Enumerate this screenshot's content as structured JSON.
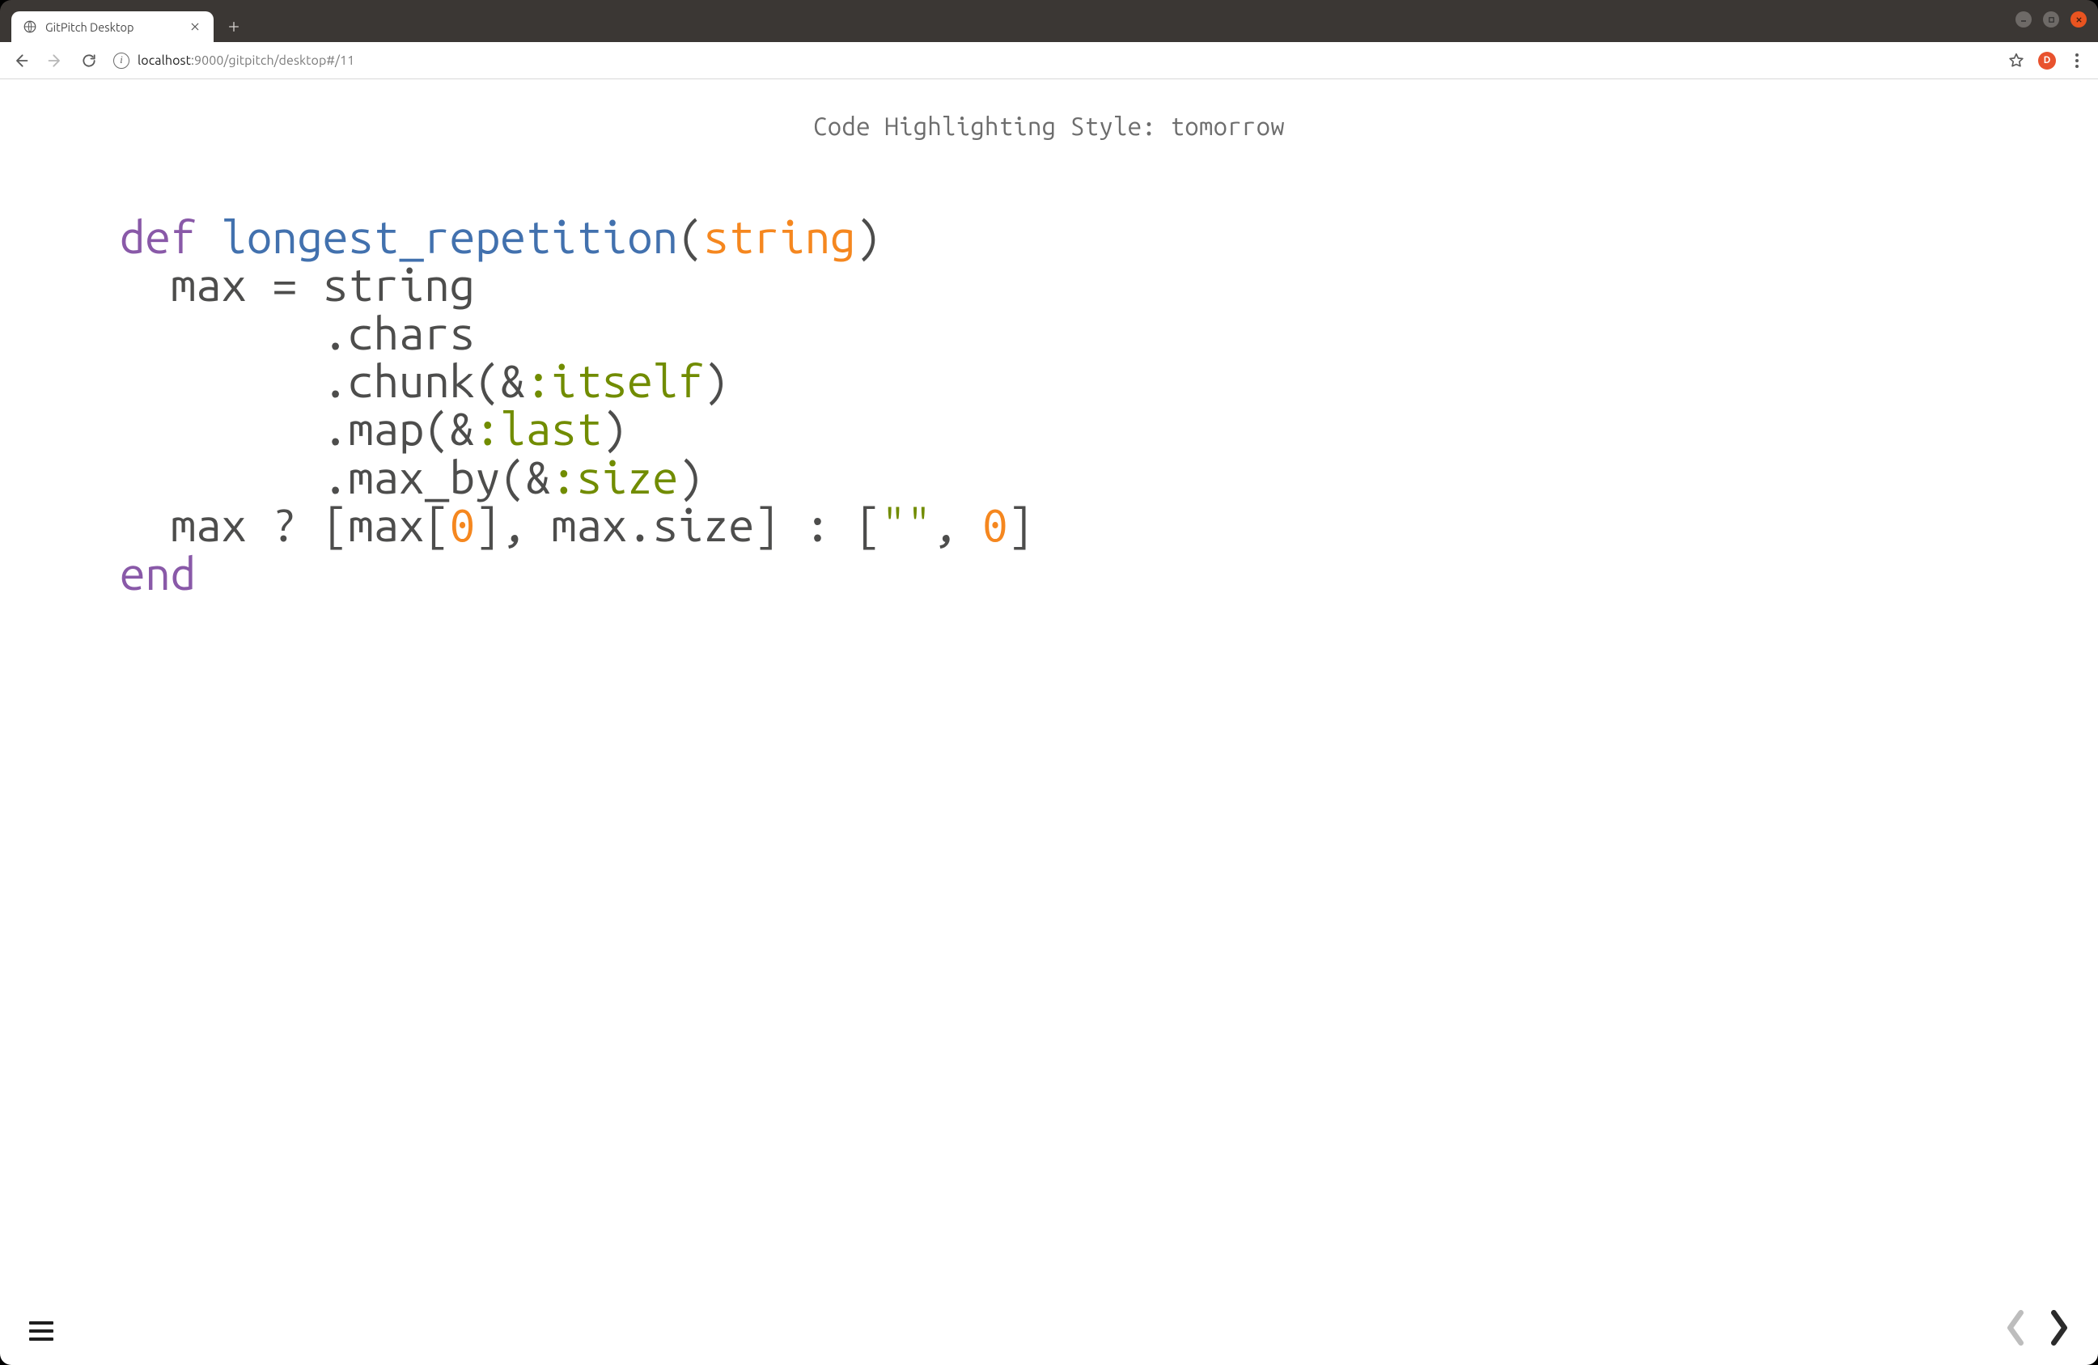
{
  "window": {
    "tab_title": "GitPitch Desktop",
    "profile_initial": "D"
  },
  "address_bar": {
    "info_glyph": "i",
    "host_strong": "localhost",
    "host_rest": ":9000/gitpitch/desktop#/11"
  },
  "slide": {
    "title": "Code Highlighting Style: tomorrow"
  },
  "code": {
    "l1_kw": "def",
    "l1_fn": "longest_repetition",
    "l1_arg": "string",
    "l2": "  max = string",
    "l3": "        .chars",
    "l4a": "        .chunk(&",
    "l4_sym": ":itself",
    "l4b": ")",
    "l5a": "        .map(&",
    "l5_sym": ":last",
    "l5b": ")",
    "l6a": "        .max_by(&",
    "l6_sym": ":size",
    "l6b": ")",
    "l7a": "  max ? [max[",
    "l7_num1": "0",
    "l7b": "], max.size] : [",
    "l7_str": "\"\"",
    "l7c": ", ",
    "l7_num2": "0",
    "l7d": "]",
    "l8_kw": "end"
  }
}
